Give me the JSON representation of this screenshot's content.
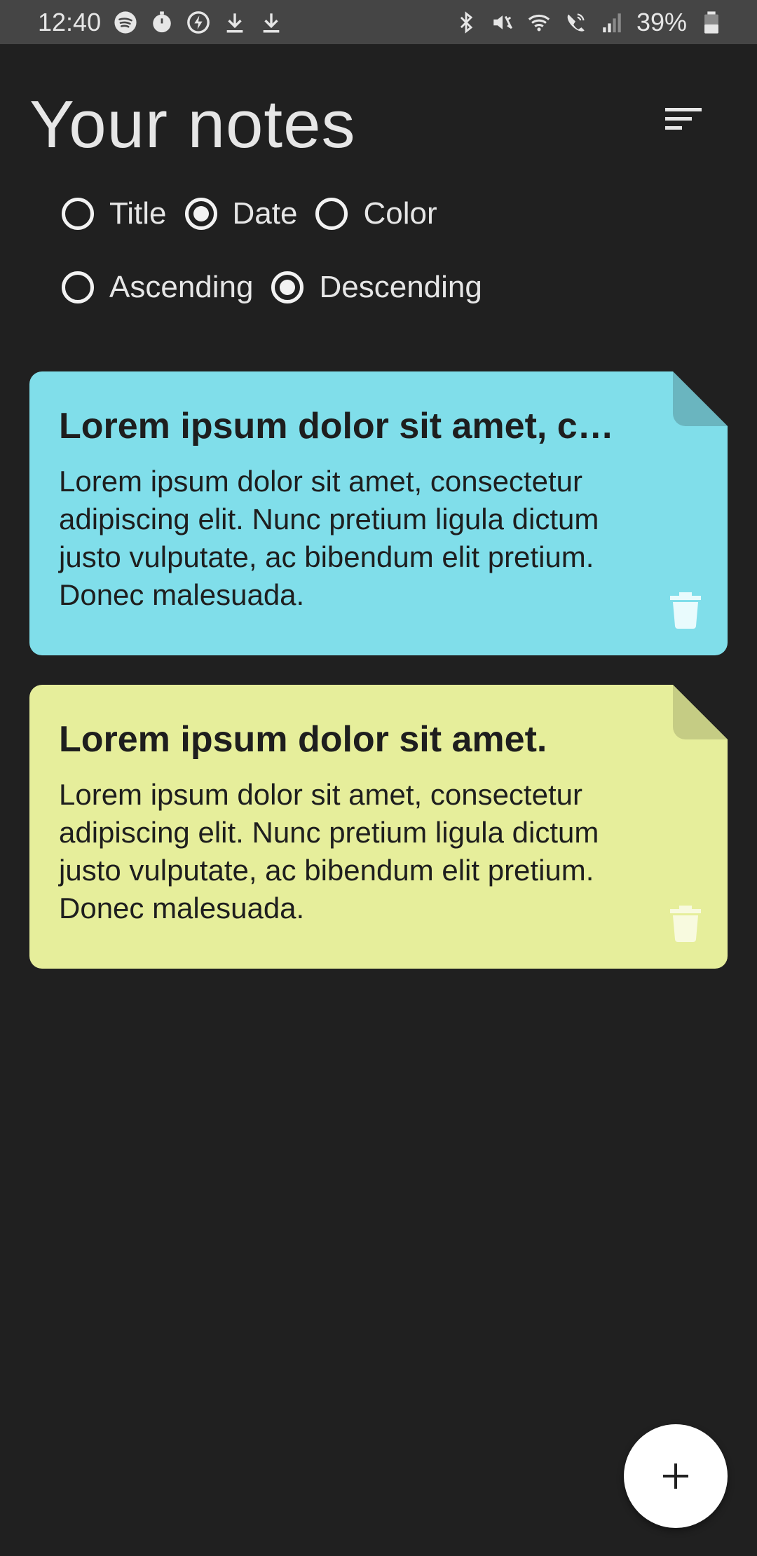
{
  "status_bar": {
    "time": "12:40",
    "battery": "39%",
    "left_icons": [
      "spotify-icon",
      "timer-icon",
      "power-icon",
      "download-icon",
      "download-icon"
    ],
    "right_icons": [
      "bluetooth-icon",
      "mute-icon",
      "wifi-icon",
      "wifi-calling-icon",
      "signal-icon",
      "battery-icon"
    ]
  },
  "header": {
    "title": "Your notes",
    "sort_icon": "sort-icon"
  },
  "sort_options": {
    "order_by": [
      {
        "label": "Title",
        "selected": false
      },
      {
        "label": "Date",
        "selected": true
      },
      {
        "label": "Color",
        "selected": false
      }
    ],
    "direction": [
      {
        "label": "Ascending",
        "selected": false
      },
      {
        "label": "Descending",
        "selected": true
      }
    ]
  },
  "notes": [
    {
      "title": "Lorem ipsum dolor sit amet, c…",
      "body": "Lorem ipsum dolor sit amet, consectetur adipiscing elit. Nunc pretium ligula dictum justo vulputate, ac bibendum elit pretium. Donec malesuada.",
      "color": "#80deea",
      "fold_color": "#6ab5bf"
    },
    {
      "title": "Lorem ipsum dolor sit amet.",
      "body": "Lorem ipsum dolor sit amet, consectetur adipiscing elit. Nunc pretium ligula dictum justo vulputate, ac bibendum elit pretium. Donec malesuada.",
      "color": "#e6ee9b",
      "fold_color": "#c5cc84"
    }
  ],
  "fab": {
    "icon": "plus-icon"
  },
  "colors": {
    "background": "#202020",
    "status_bar": "#454545",
    "text": "#e6e6e6"
  }
}
